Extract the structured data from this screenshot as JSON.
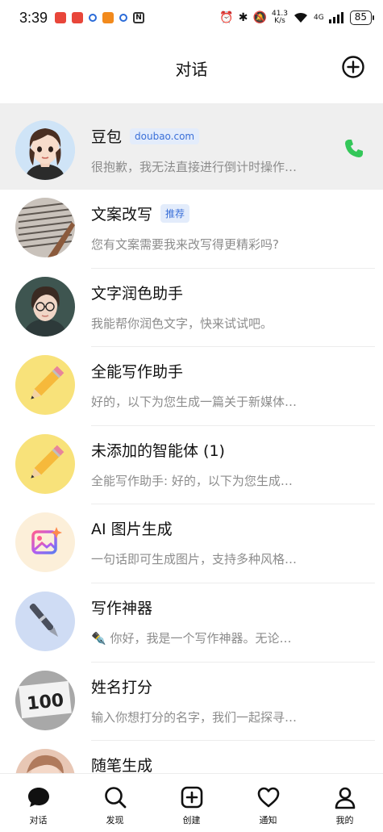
{
  "status_bar": {
    "time": "3:39",
    "net_speed_value": "41.3",
    "net_speed_unit": "K/s",
    "network": "4G",
    "battery": "85"
  },
  "header": {
    "title": "对话"
  },
  "chats": [
    {
      "name": "豆包",
      "tag": "doubao.com",
      "preview": "很抱歉，我无法直接进行倒计时操作…",
      "pinned": true
    },
    {
      "name": "文案改写",
      "tag": "推荐",
      "preview": "您有文案需要我来改写得更精彩吗?"
    },
    {
      "name": "文字润色助手",
      "preview": "我能帮你润色文字，快来试试吧。"
    },
    {
      "name": "全能写作助手",
      "preview": "好的，以下为您生成一篇关于新媒体…"
    },
    {
      "name": "未添加的智能体 (1)",
      "preview": "全能写作助手: 好的，以下为您生成…"
    },
    {
      "name": "AI 图片生成",
      "preview": "一句话即可生成图片，支持多种风格…"
    },
    {
      "name": "写作神器",
      "preview": "✒️ 你好，我是一个写作神器。无论…"
    },
    {
      "name": "姓名打分",
      "preview": "输入你想打分的名字，我们一起探寻…"
    },
    {
      "name": "随笔生成",
      "preview": ""
    }
  ],
  "score_text": "100",
  "tabs": [
    {
      "label": "对话",
      "icon": "chat-bubble-icon",
      "active": true
    },
    {
      "label": "发现",
      "icon": "search-icon"
    },
    {
      "label": "创建",
      "icon": "create-plus-icon"
    },
    {
      "label": "通知",
      "icon": "heart-icon"
    },
    {
      "label": "我的",
      "icon": "profile-icon"
    }
  ],
  "colors": {
    "accent_green": "#34c759",
    "tag_blue": "#3a6fd8",
    "pinned_bg": "#efefef"
  }
}
